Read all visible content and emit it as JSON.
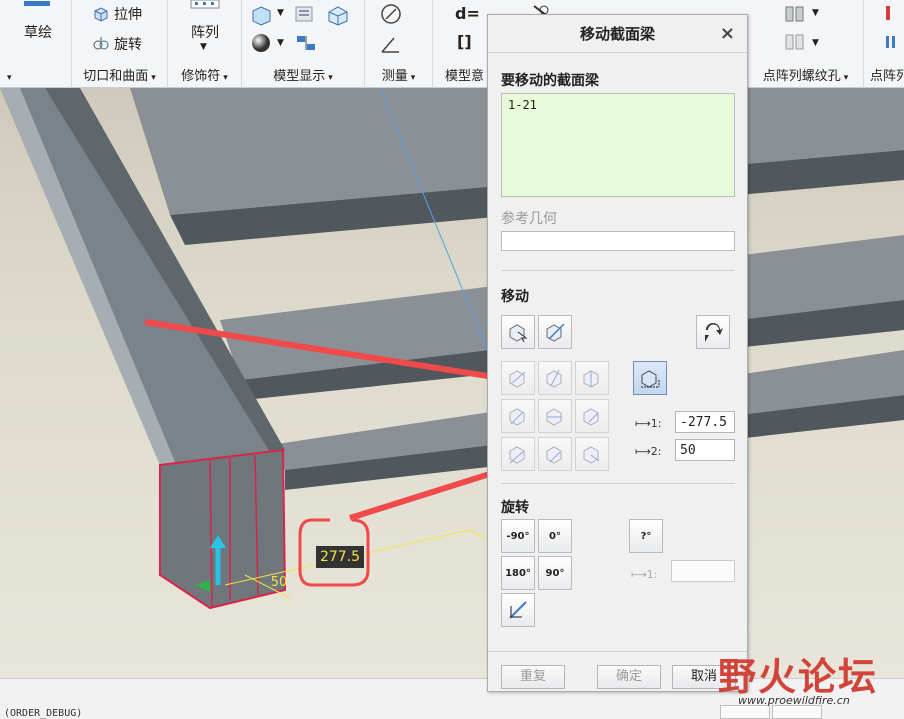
{
  "ribbon": {
    "sketch_label": "草绘",
    "extrude_label": "拉伸",
    "revolve_label": "旋转",
    "pattern_label": "阵列",
    "groups": {
      "cut_surface": "切口和曲面",
      "modifiers": "修饰符",
      "model_display": "模型显示",
      "measure": "测量",
      "model_intent": "模型意",
      "point_pattern_thread": "点阵列螺纹孔",
      "point_pattern2": "点阵列"
    }
  },
  "viewport": {
    "dimension_main": "277.5",
    "dimension_small": "50"
  },
  "dialog": {
    "title": "移动截面梁",
    "close_glyph": "×",
    "beams_label": "要移动的截面梁",
    "beams_value": "1-21",
    "ref_geom_label": "参考几何",
    "ref_geom_value": "",
    "move_label": "移动",
    "offset1_label": "1:",
    "offset1_value": "-277.5",
    "offset2_label": "2:",
    "offset2_value": "50",
    "rotate_label": "旋转",
    "rot_buttons": {
      "neg90": "-90°",
      "zero": "0°",
      "r180": "180°",
      "r90": "90°",
      "custom": "?°"
    },
    "rot_value_label": "1:",
    "rot_value": "",
    "repeat_label": "重复",
    "ok_label": "确定",
    "cancel_label": "取消"
  },
  "status": {
    "text": "(ORDER_DEBUG)"
  },
  "watermark": {
    "brand": "野火论坛",
    "url": "www.proewildfire.cn"
  },
  "colors": {
    "highlight_green": "#e7fbd8",
    "arrow_red": "#f04a4a",
    "beam_gray": "#7f868c",
    "dim_yellow": "#f5e34a"
  }
}
